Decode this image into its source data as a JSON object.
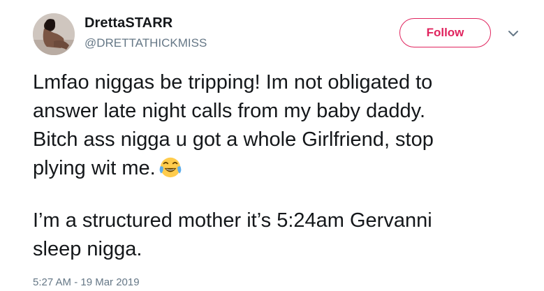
{
  "user": {
    "display_name": "DrettaSTARR",
    "handle": "@DRETTATHICKMISS"
  },
  "actions": {
    "follow_label": "Follow",
    "accent_color": "#e0245e"
  },
  "tweet": {
    "lines_p1": [
      "Lmfao niggas be tripping! Im not obligated to",
      "answer late night calls from my baby daddy.",
      "Bitch ass nigga u got a whole Girlfriend, stop",
      "plying wit me."
    ],
    "emoji": "face-with-tears-of-joy-icon",
    "lines_p2": [
      "I’m a structured mother it’s 5:24am Gervanni",
      "sleep nigga."
    ],
    "timestamp": "5:27 AM - 19 Mar 2019"
  }
}
